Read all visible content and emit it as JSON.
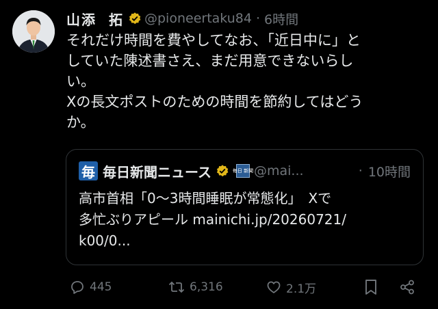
{
  "post": {
    "author_name": "山添",
    "author_name_2": "拓",
    "handle": "@pioneertaku84",
    "separator": "·",
    "time": "6時間",
    "lines": [
      "それだけ時間を費やしてなお、「近日中に」と",
      "していた陳述書さえ、まだ用意できないらし",
      "い。",
      "Xの長文ポストのための時間を節約してはどう",
      "か。"
    ]
  },
  "quote": {
    "logo_char": "毎",
    "name": "毎日新聞ニュース",
    "badge_text": "毎日\n新聞",
    "handle": "@mai...",
    "separator": "·",
    "time": "10時間",
    "lines": [
      "高市首相「0〜3時間睡眠が常態化」　Xで",
      "多忙ぶりアピール mainichi.jp/20260721/",
      "k00/0..."
    ]
  },
  "actions": {
    "replies": "445",
    "reposts": "6,316",
    "likes": "2.1万"
  },
  "colors": {
    "background": "#000000",
    "text": "#e7e9ea",
    "muted": "#71767b",
    "verified_gold": "#e2b719",
    "border": "#2f3336",
    "logo_blue": "#1f5fa8"
  },
  "icons": [
    "verified-badge-icon",
    "reply-icon",
    "repost-icon",
    "like-icon",
    "bookmark-icon",
    "share-icon"
  ]
}
